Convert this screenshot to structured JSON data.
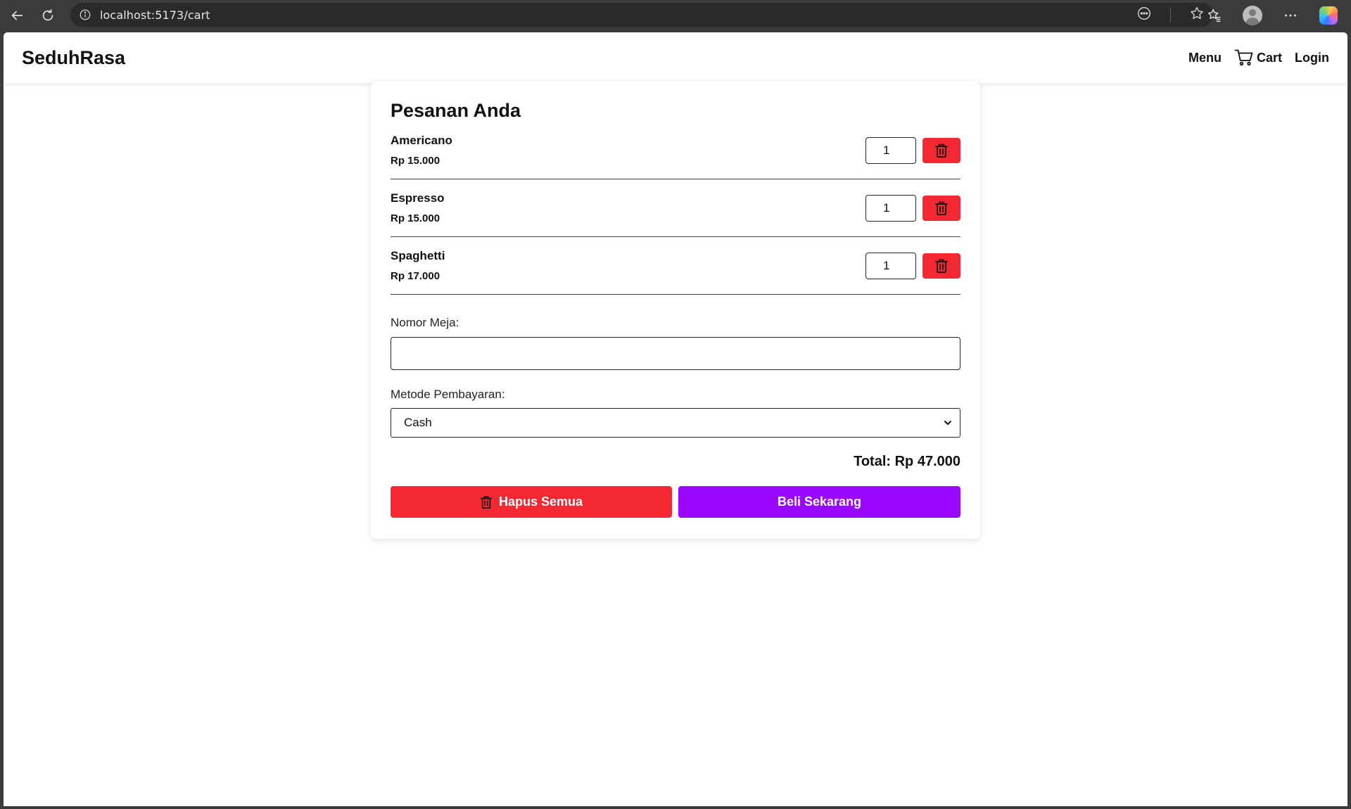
{
  "browser": {
    "url": "localhost:5173/cart",
    "icons": [
      "back-arrow-icon",
      "reload-icon",
      "info-icon",
      "reading-mode-icon",
      "star-icon",
      "favorites-icon",
      "profile-icon",
      "more-icon",
      "copilot-icon"
    ]
  },
  "header": {
    "brand": "SeduhRasa",
    "nav": {
      "menu": "Menu",
      "cart": "Cart",
      "login": "Login"
    }
  },
  "cart": {
    "title": "Pesanan Anda",
    "items": [
      {
        "name": "Americano",
        "price": "Rp 15.000",
        "qty": "1"
      },
      {
        "name": "Espresso",
        "price": "Rp 15.000",
        "qty": "1"
      },
      {
        "name": "Spaghetti",
        "price": "Rp 17.000",
        "qty": "1"
      }
    ],
    "table_label": "Nomor Meja:",
    "table_value": "",
    "payment_label": "Metode Pembayaran:",
    "payment_selected": "Cash",
    "total": "Total: Rp 47.000",
    "clear_label": "Hapus Semua",
    "buy_label": "Beli Sekarang"
  },
  "colors": {
    "danger": "#f42832",
    "primary": "#9a08ff",
    "text": "#111111"
  }
}
